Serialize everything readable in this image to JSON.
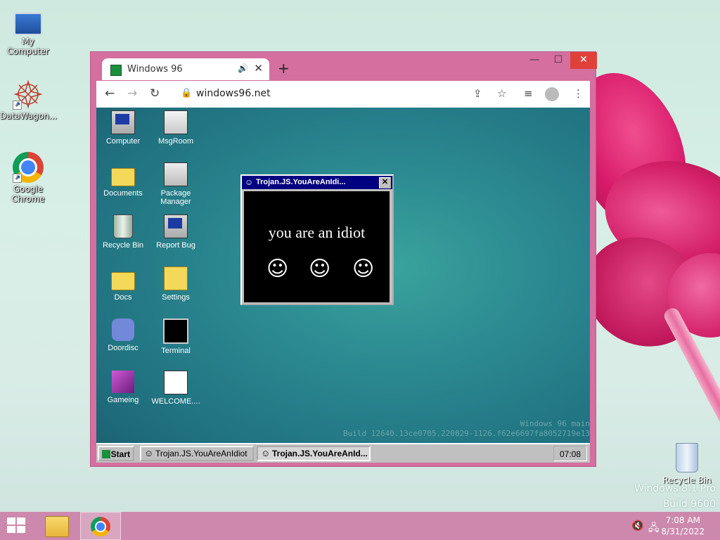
{
  "host_desktop": {
    "icons": [
      {
        "label": "My Computer"
      },
      {
        "label": "DataWagon..."
      },
      {
        "label": "Google Chrome"
      }
    ],
    "recycle_bin": "Recycle Bin",
    "watermark": {
      "line1": "Windows 8.1 Pro",
      "line2": "Build 9600"
    }
  },
  "browser": {
    "tab_title": "Windows 96",
    "new_tab": "+",
    "url": "windows96.net",
    "window_controls": {
      "minimize": "—",
      "maximize": "☐",
      "close": "✕"
    }
  },
  "w96": {
    "icons": [
      {
        "label": "Computer"
      },
      {
        "label": "MsgRoom"
      },
      {
        "label": "Documents"
      },
      {
        "label": "Package Manager"
      },
      {
        "label": "Recycle Bin"
      },
      {
        "label": "Report Bug"
      },
      {
        "label": "Docs"
      },
      {
        "label": "Settings"
      },
      {
        "label": "Doordisc"
      },
      {
        "label": "Terminal"
      },
      {
        "label": "Gameing"
      },
      {
        "label": "WELCOME...."
      }
    ],
    "build_text": {
      "line1": "Windows 96 main",
      "line2": "Build 12640.13ce0705.220829-1126.f62e6697fa8052719e13"
    },
    "trojan_window": {
      "title": "Trojan.JS.YouAreAnIdi...",
      "message": "you are an idiot",
      "smiley": "☺"
    },
    "taskbar": {
      "start": "Start",
      "buttons": [
        "Trojan.JS.YouAreAnIdiot",
        "Trojan.JS.YouAreAnId..."
      ],
      "clock": "07:08"
    }
  },
  "host_taskbar": {
    "time": "7:08 AM",
    "date": "8/31/2022"
  }
}
